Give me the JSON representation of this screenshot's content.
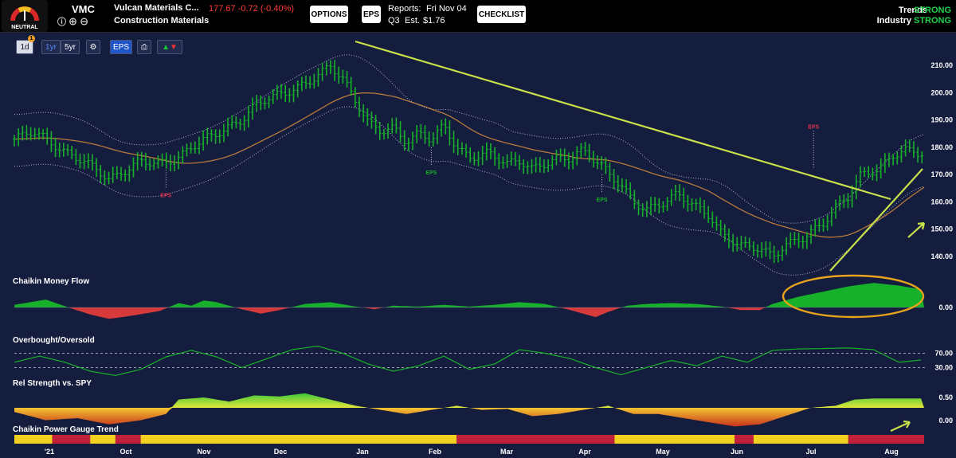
{
  "header": {
    "gauge_label": "NEUTRAL",
    "ticker": "VMC",
    "company": "Vulcan Materials C...",
    "industry_name": "Construction Materials",
    "price_change": "177.67 -0.72 (-0.40%)",
    "options_label": "OPTIONS",
    "eps_badge": "EPS",
    "reports_label": "Reports:",
    "reports_date": "Fri Nov 04",
    "quarter": "Q3",
    "est_label": "Est.",
    "est_value": "$1.76",
    "checklist_label": "CHECKLIST",
    "trends_label": "Trends",
    "trends_value": "STRONG",
    "industry_label": "Industry",
    "industry_value": "STRONG"
  },
  "toolbar": {
    "range_1d": "1d",
    "badge": "1",
    "range_1yr": "1yr",
    "range_5yr": "5yr",
    "eps_toggle": "EPS"
  },
  "colors": {
    "background": "#151d3e",
    "green": "#17b02a",
    "red": "#d63a3a",
    "yellow": "#f2d021",
    "trendline": "#c8e04a",
    "ma": "#b87a3c",
    "highlight": "#e8a31c"
  },
  "chart_data": [
    {
      "type": "candlestick",
      "name": "price",
      "yticks": [
        "210.00",
        "200.00",
        "190.00",
        "180.00",
        "170.00",
        "160.00",
        "150.00",
        "140.00"
      ],
      "ylim": [
        133,
        217
      ],
      "x_ticks": [
        "'21",
        "Oct",
        "Nov",
        "Dec",
        "Jan",
        "Feb",
        "Mar",
        "Apr",
        "May",
        "Jun",
        "Jul",
        "Aug"
      ],
      "points": [
        [
          0,
          183
        ],
        [
          0.3,
          186
        ],
        [
          0.5,
          183
        ],
        [
          0.8,
          178
        ],
        [
          1.1,
          175
        ],
        [
          1.3,
          172
        ],
        [
          1.5,
          168
        ],
        [
          1.8,
          172
        ],
        [
          2.0,
          175
        ],
        [
          2.3,
          174
        ],
        [
          2.6,
          176
        ],
        [
          2.8,
          180
        ],
        [
          3.0,
          183
        ],
        [
          3.3,
          186
        ],
        [
          3.6,
          190
        ],
        [
          3.8,
          195
        ],
        [
          4.0,
          198
        ],
        [
          4.3,
          200
        ],
        [
          4.6,
          203
        ],
        [
          4.9,
          208
        ],
        [
          5.0,
          210
        ],
        [
          5.2,
          205
        ],
        [
          5.4,
          197
        ],
        [
          5.6,
          189
        ],
        [
          5.8,
          186
        ],
        [
          6.0,
          187
        ],
        [
          6.2,
          182
        ],
        [
          6.4,
          185
        ],
        [
          6.6,
          183
        ],
        [
          6.8,
          188
        ],
        [
          7.0,
          180
        ],
        [
          7.2,
          176
        ],
        [
          7.5,
          178
        ],
        [
          7.8,
          174
        ],
        [
          8.0,
          175
        ],
        [
          8.2,
          172
        ],
        [
          8.6,
          176
        ],
        [
          8.8,
          176
        ],
        [
          9.0,
          179
        ],
        [
          9.3,
          173
        ],
        [
          9.6,
          166
        ],
        [
          9.8,
          160
        ],
        [
          10.0,
          157
        ],
        [
          10.3,
          160
        ],
        [
          10.5,
          163
        ],
        [
          10.8,
          158
        ],
        [
          11.0,
          155
        ],
        [
          11.2,
          148
        ],
        [
          11.5,
          144
        ],
        [
          11.8,
          143
        ],
        [
          12.0,
          140
        ],
        [
          12.2,
          144
        ],
        [
          12.5,
          147
        ],
        [
          12.8,
          152
        ],
        [
          13.0,
          158
        ],
        [
          13.2,
          162
        ],
        [
          13.4,
          170
        ],
        [
          13.7,
          172
        ],
        [
          13.9,
          177
        ],
        [
          14.1,
          179
        ],
        [
          14.3,
          178
        ]
      ],
      "eps_markers": [
        {
          "x": 2.4,
          "label": "EPS",
          "color": "red"
        },
        {
          "x": 6.6,
          "label": "EPS",
          "color": "green"
        },
        {
          "x": 9.3,
          "label": "EPS",
          "color": "green"
        },
        {
          "x": 12.65,
          "label": "EPS",
          "color": "red"
        }
      ]
    },
    {
      "type": "area",
      "name": "money_flow",
      "title": "Chaikin Money Flow",
      "yticks": [
        "0.00"
      ],
      "points": [
        [
          0,
          0.3
        ],
        [
          0.5,
          0.9
        ],
        [
          0.9,
          -0.1
        ],
        [
          1.2,
          -0.8
        ],
        [
          1.5,
          -1.3
        ],
        [
          1.9,
          -0.9
        ],
        [
          2.3,
          -0.4
        ],
        [
          2.6,
          0.5
        ],
        [
          2.8,
          0.2
        ],
        [
          3.0,
          0.8
        ],
        [
          3.2,
          0.6
        ],
        [
          3.6,
          -0.2
        ],
        [
          3.9,
          -0.7
        ],
        [
          4.2,
          -0.3
        ],
        [
          4.6,
          0.4
        ],
        [
          5.0,
          0.6
        ],
        [
          5.4,
          0.1
        ],
        [
          5.7,
          -0.2
        ],
        [
          6.0,
          0.2
        ],
        [
          6.4,
          0.1
        ],
        [
          6.8,
          0.3
        ],
        [
          7.2,
          0.1
        ],
        [
          7.6,
          0.3
        ],
        [
          8.0,
          0.6
        ],
        [
          8.4,
          0.4
        ],
        [
          8.8,
          -0.3
        ],
        [
          9.2,
          -1.1
        ],
        [
          9.4,
          -0.5
        ],
        [
          9.7,
          0.2
        ],
        [
          10.0,
          0.4
        ],
        [
          10.4,
          0.5
        ],
        [
          10.8,
          0.4
        ],
        [
          11.2,
          0.1
        ],
        [
          11.5,
          -0.3
        ],
        [
          11.8,
          -0.3
        ],
        [
          12.0,
          0.4
        ],
        [
          12.4,
          1.2
        ],
        [
          12.8,
          1.8
        ],
        [
          13.2,
          2.4
        ],
        [
          13.6,
          2.8
        ],
        [
          14.0,
          2.5
        ],
        [
          14.4,
          2.0
        ]
      ]
    },
    {
      "type": "line",
      "name": "overbought_oversold",
      "title": "Overbought/Oversold",
      "yticks": [
        "70.00",
        "30.00"
      ],
      "ylim": [
        0,
        100
      ],
      "points": [
        [
          0,
          45
        ],
        [
          0.4,
          62
        ],
        [
          0.8,
          45
        ],
        [
          1.2,
          20
        ],
        [
          1.6,
          8
        ],
        [
          2.0,
          25
        ],
        [
          2.4,
          60
        ],
        [
          2.8,
          78
        ],
        [
          3.2,
          60
        ],
        [
          3.6,
          30
        ],
        [
          4.0,
          55
        ],
        [
          4.4,
          80
        ],
        [
          4.8,
          90
        ],
        [
          5.2,
          70
        ],
        [
          5.6,
          40
        ],
        [
          6.0,
          20
        ],
        [
          6.4,
          35
        ],
        [
          6.8,
          62
        ],
        [
          7.2,
          25
        ],
        [
          7.6,
          40
        ],
        [
          8.0,
          80
        ],
        [
          8.4,
          70
        ],
        [
          8.8,
          55
        ],
        [
          9.2,
          30
        ],
        [
          9.6,
          10
        ],
        [
          10.0,
          30
        ],
        [
          10.4,
          50
        ],
        [
          10.8,
          35
        ],
        [
          11.2,
          62
        ],
        [
          11.6,
          45
        ],
        [
          12.0,
          78
        ],
        [
          12.4,
          82
        ],
        [
          12.8,
          83
        ],
        [
          13.2,
          85
        ],
        [
          13.6,
          80
        ],
        [
          14.0,
          45
        ],
        [
          14.4,
          52
        ]
      ]
    },
    {
      "type": "area",
      "name": "rel_strength",
      "title": "Rel Strength vs. SPY",
      "yticks": [
        "0.50",
        "0.00"
      ],
      "points": [
        [
          0,
          -0.2
        ],
        [
          0.5,
          -0.6
        ],
        [
          1.0,
          -0.5
        ],
        [
          1.5,
          -0.8
        ],
        [
          2.0,
          -0.6
        ],
        [
          2.4,
          -0.3
        ],
        [
          2.6,
          0.4
        ],
        [
          3.0,
          0.5
        ],
        [
          3.4,
          0.3
        ],
        [
          3.8,
          0.6
        ],
        [
          4.2,
          0.55
        ],
        [
          4.6,
          0.7
        ],
        [
          5.0,
          0.4
        ],
        [
          5.4,
          0.1
        ],
        [
          5.8,
          -0.1
        ],
        [
          6.2,
          -0.3
        ],
        [
          6.6,
          -0.1
        ],
        [
          7.0,
          0.1
        ],
        [
          7.4,
          -0.1
        ],
        [
          7.8,
          -0.05
        ],
        [
          8.2,
          -0.4
        ],
        [
          8.6,
          -0.3
        ],
        [
          9.0,
          -0.1
        ],
        [
          9.4,
          0.1
        ],
        [
          9.8,
          -0.3
        ],
        [
          10.2,
          -0.3
        ],
        [
          10.6,
          -0.5
        ],
        [
          11.0,
          -0.7
        ],
        [
          11.4,
          -0.9
        ],
        [
          11.8,
          -0.8
        ],
        [
          12.2,
          -0.4
        ],
        [
          12.6,
          0.0
        ],
        [
          13.0,
          0.1
        ],
        [
          13.3,
          0.4
        ],
        [
          13.6,
          0.45
        ],
        [
          14.0,
          0.45
        ]
      ]
    },
    {
      "type": "bar",
      "name": "power_gauge_trend",
      "title": "Chaikin Power Gauge Trend",
      "segments": [
        [
          "yellow",
          0,
          0.6
        ],
        [
          "red",
          0.6,
          1.2
        ],
        [
          "yellow",
          1.2,
          1.6
        ],
        [
          "red",
          1.6,
          2.0
        ],
        [
          "yellow",
          2.0,
          7.0
        ],
        [
          "red",
          7.0,
          9.5
        ],
        [
          "yellow",
          9.5,
          11.4
        ],
        [
          "red",
          11.4,
          11.7
        ],
        [
          "yellow",
          11.7,
          13.2
        ],
        [
          "red",
          13.2,
          14.4
        ]
      ]
    }
  ]
}
